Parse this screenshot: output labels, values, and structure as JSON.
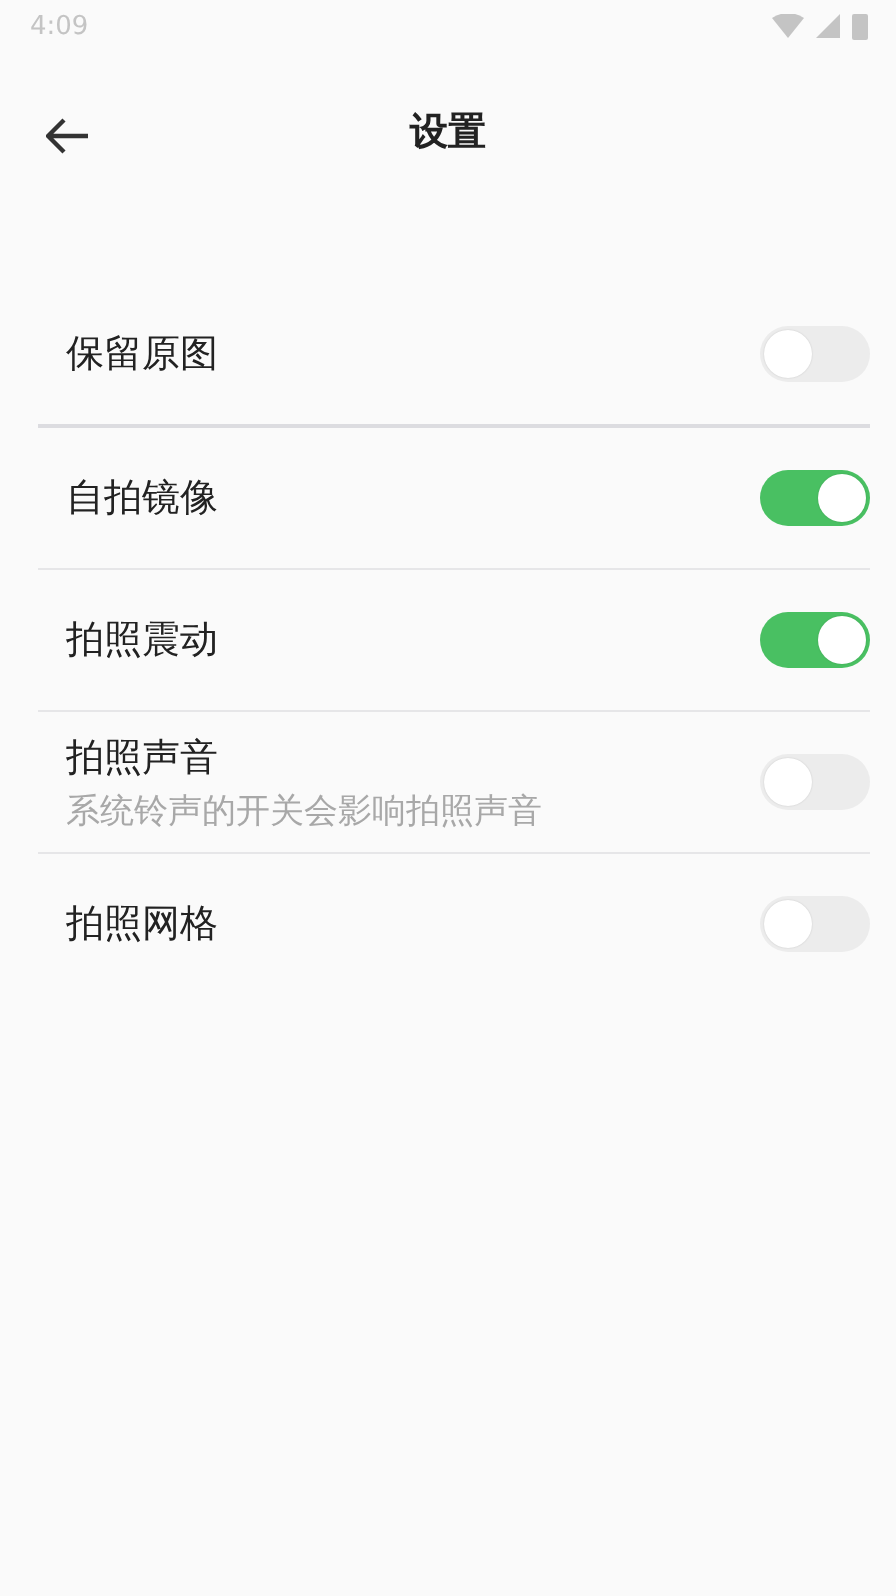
{
  "status_bar": {
    "time": "4:09"
  },
  "header": {
    "title": "设置"
  },
  "settings": [
    {
      "label": "保留原图",
      "on": false
    },
    {
      "label": "自拍镜像",
      "on": true
    },
    {
      "label": "拍照震动",
      "on": true
    },
    {
      "label": "拍照声音",
      "description": "系统铃声的开关会影响拍照声音",
      "on": false
    },
    {
      "label": "拍照网格",
      "on": false
    }
  ]
}
